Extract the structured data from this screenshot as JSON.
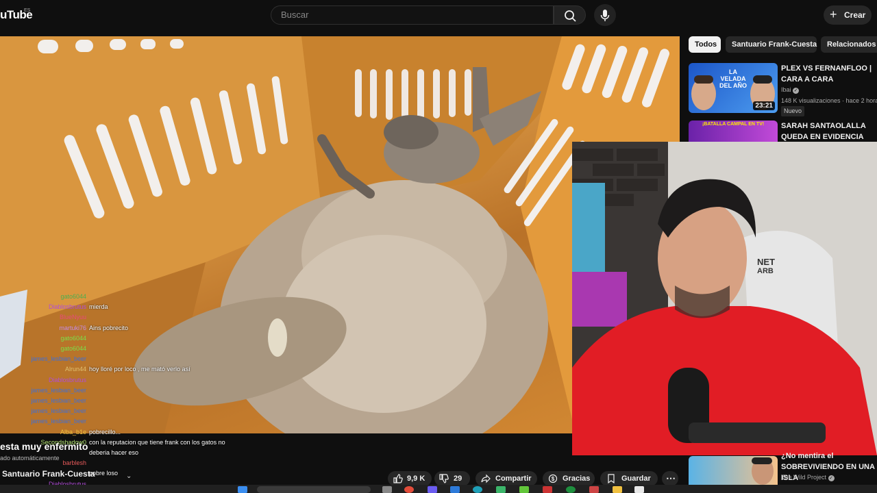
{
  "header": {
    "logo_text": "uTube",
    "logo_country": "ES",
    "search_placeholder": "Buscar",
    "create_label": "Crear"
  },
  "chat": [
    {
      "user": "gato6044",
      "msg": "",
      "color": "#4caf50"
    },
    {
      "user": "Diablosbrutus",
      "msg": "mierda",
      "color": "#b04cd8"
    },
    {
      "user": "BlueNyuu",
      "msg": "",
      "color": "#e84a7a"
    },
    {
      "user": "martuki76",
      "msg": "Ains pobrecito",
      "color": "#c58ae6"
    },
    {
      "user": "gato6044",
      "msg": "",
      "color": "#7be04a"
    },
    {
      "user": "gato6044",
      "msg": "",
      "color": "#7be04a"
    },
    {
      "user": "james_lesbian_beer",
      "msg": "",
      "color": "#3f6fd8"
    },
    {
      "user": "Alrun44",
      "msg": "hoy lloré por loco , me mató verlo así",
      "color": "#e0c170"
    },
    {
      "user": "Diablosbrutus",
      "msg": "",
      "color": "#b04cd8"
    },
    {
      "user": "james_lesbian_beer",
      "msg": "",
      "color": "#3f6fd8"
    },
    {
      "user": "james_lesbian_beer",
      "msg": "",
      "color": "#3f6fd8"
    },
    {
      "user": "james_lesbian_beer",
      "msg": "",
      "color": "#3f6fd8"
    },
    {
      "user": "james_lesbian_beer",
      "msg": "",
      "color": "#3f6fd8"
    },
    {
      "user": "Alba_b1e",
      "msg": "pobrecillo...",
      "color": "#f0c040"
    },
    {
      "user": "Secondshadow0",
      "msg": "con la reputacion que tiene frank con los gatos no",
      "color": "#b0e070"
    },
    {
      "user": "",
      "msg": "deberia hacer eso",
      "color": "#ffffff"
    },
    {
      "user": "barblesh",
      "msg": "",
      "color": "#e85a5a"
    },
    {
      "user": "",
      "msg": "pobre loso",
      "color": "#ffffff"
    },
    {
      "user": "Diablosbrutus",
      "msg": "",
      "color": "#b04cd8"
    }
  ],
  "video": {
    "title": "esta muy enfermito",
    "auto_label": "ado automáticamente",
    "channel": "Santuario Frank-Cuesta"
  },
  "actions": {
    "likes": "9,9 K",
    "comments": "29",
    "share": "Compartir",
    "thanks": "Gracias",
    "save": "Guardar"
  },
  "chips": [
    "Todos",
    "Santuario Frank-Cuesta",
    "Relacionados"
  ],
  "recommendations": [
    {
      "title": "PLEX VS FERNANFLOO | CARA A CARA",
      "channel": "Ibai",
      "views": "148 K visualizaciones · hace 2 horas",
      "duration": "23:21",
      "badge": "Nuevo",
      "thumb_text": "LA VELADA DEL AÑO"
    },
    {
      "title": "SARAH SANTAOLALLA QUEDA EN EVIDENCIA TRAS ...",
      "thumb_text": "¡BATALLA CAMPAL EN TV!"
    },
    {
      "title": "¿No mentira el SOBREVIVIENDO EN UNA ISLA",
      "channel": "The Wild Project"
    }
  ],
  "webcam": {
    "chair_text": "NET ARB"
  }
}
